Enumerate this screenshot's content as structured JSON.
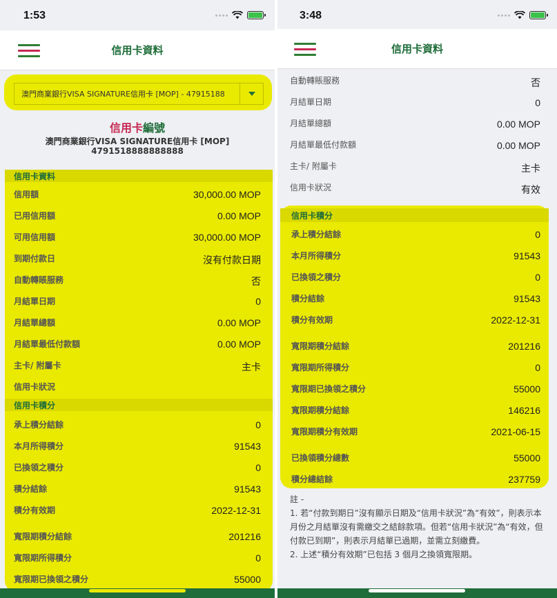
{
  "left": {
    "status_time": "1:53",
    "nav_title": "信用卡資料",
    "card_select_value": "澳門商業銀行VISA SIGNATURE信用卡 [MOP] - 47915188",
    "card_no_title_a": "信用卡",
    "card_no_title_b": "編號",
    "card_name": "澳門商業銀行VISA SIGNATURE信用卡 [MOP]",
    "card_number": "4791518888888888",
    "section_card_info": "信用卡資料",
    "card_info_rows": [
      {
        "label": "信用額",
        "value": "30,000.00 MOP"
      },
      {
        "label": "已用信用額",
        "value": "0.00 MOP"
      },
      {
        "label": "可用信用額",
        "value": "30,000.00 MOP"
      },
      {
        "label": "到期付款日",
        "value": "沒有付款日期"
      },
      {
        "label": "自動轉賬服務",
        "value": "否"
      },
      {
        "label": "月結單日期",
        "value": "0"
      },
      {
        "label": "月結單總額",
        "value": "0.00 MOP"
      },
      {
        "label": "月結單最低付款額",
        "value": "0.00 MOP"
      },
      {
        "label": "主卡/ 附屬卡",
        "value": "主卡"
      },
      {
        "label": "信用卡狀況",
        "value": ""
      }
    ],
    "section_points": "信用卡積分",
    "points_rows": [
      {
        "label": "承上積分結餘",
        "value": "0"
      },
      {
        "label": "本月所得積分",
        "value": "91543"
      },
      {
        "label": "已換領之積分",
        "value": "0"
      },
      {
        "label": "積分結餘",
        "value": "91543"
      },
      {
        "label": "積分有效期",
        "value": "2022-12-31"
      },
      {
        "label": "寬限期積分結餘",
        "value": "201216"
      },
      {
        "label": "寬限期所得積分",
        "value": "0"
      },
      {
        "label": "寬限期已換領之積分",
        "value": "55000"
      }
    ]
  },
  "right": {
    "status_time": "3:48",
    "nav_title": "信用卡資料",
    "card_info_rows": [
      {
        "label": "自動轉賬服務",
        "value": "否"
      },
      {
        "label": "月結單日期",
        "value": "0"
      },
      {
        "label": "月結單總額",
        "value": "0.00 MOP"
      },
      {
        "label": "月結單最低付款額",
        "value": "0.00 MOP"
      },
      {
        "label": "主卡/ 附屬卡",
        "value": "主卡"
      },
      {
        "label": "信用卡狀況",
        "value": "有效"
      }
    ],
    "section_points": "信用卡積分",
    "points_rows": [
      {
        "label": "承上積分結餘",
        "value": "0"
      },
      {
        "label": "本月所得積分",
        "value": "91543"
      },
      {
        "label": "已換領之積分",
        "value": "0"
      },
      {
        "label": "積分結餘",
        "value": "91543"
      },
      {
        "label": "積分有效期",
        "value": "2022-12-31"
      },
      {
        "label": "寬限期積分結餘",
        "value": "201216"
      },
      {
        "label": "寬限期所得積分",
        "value": "0"
      },
      {
        "label": "寬限期已換領之積分",
        "value": "55000"
      },
      {
        "label": "寬限期積分結餘",
        "value": "146216"
      },
      {
        "label": "寬限期積分有效期",
        "value": "2021-06-15"
      },
      {
        "label": "已換領積分總數",
        "value": "55000"
      },
      {
        "label": "積分總結餘",
        "value": "237759"
      }
    ],
    "notes_title": "註 -",
    "notes_1": "1. 若“付款到期日”沒有顯示日期及“信用卡狀況”為“有效”，則表示本月份之月結單沒有需繳交之結餘款項。但若“信用卡狀況”為“有效，但付款已到期”，則表示月結單已過期，並需立刻繳費。",
    "notes_2": "2. 上述“積分有效期”已包括 3 個月之換領寬限期。"
  },
  "colors": {
    "highlight": "#eaea00",
    "brand_green": "#1f6d3a",
    "brand_red": "#c62853"
  }
}
